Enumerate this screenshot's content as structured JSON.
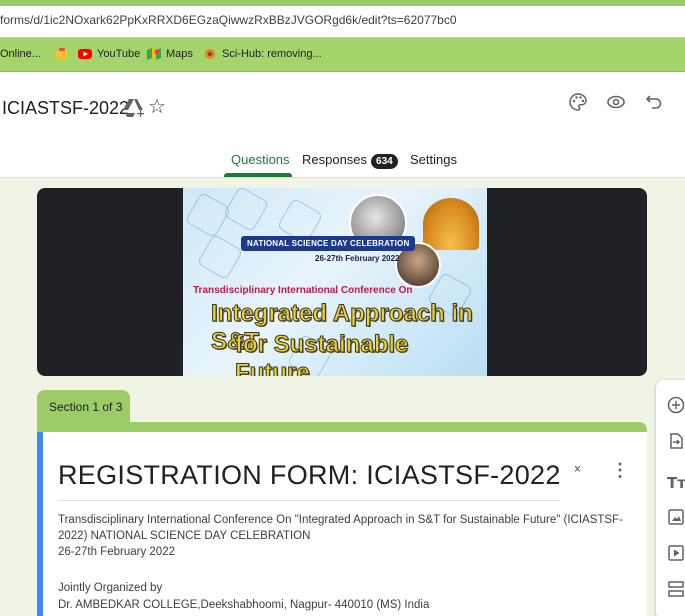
{
  "browser": {
    "url": "forms/d/1ic2NOxark62PpKxRRXD6EGzaQiwwzRxBBzJVGORgd6k/edit?ts=62077bc0",
    "bookmarks": [
      {
        "label": "Online...",
        "icon": "bookmark-page-icon"
      },
      {
        "label": "",
        "icon": "flipkart-icon"
      },
      {
        "label": "YouTube",
        "icon": "youtube-icon"
      },
      {
        "label": "Maps",
        "icon": "maps-icon"
      },
      {
        "label": "Sci-Hub: removing...",
        "icon": "scihub-icon"
      }
    ]
  },
  "header": {
    "doc_title": "ICIASTSF-2022",
    "icons": [
      "move-to-drive-icon",
      "star-icon",
      "palette-icon",
      "preview-eye-icon",
      "undo-icon"
    ],
    "tabs": [
      {
        "label": "Questions",
        "active": true
      },
      {
        "label": "Responses",
        "badge": "634"
      },
      {
        "label": "Settings"
      }
    ]
  },
  "banner": {
    "national_day": "NATIONAL SCIENCE DAY CELEBRATION",
    "dates": "26-27th February 2022",
    "conference": "Transdisciplinary International Conference On",
    "headline_1": "Integrated Approach in S&T",
    "headline_2": "for Sustainable Future"
  },
  "section": {
    "label": "Section 1 of 3",
    "form_title": "REGISTRATION FORM: ICIASTSF-2022",
    "description_lines": [
      "Transdisciplinary International Conference On \"Integrated Approach in S&T for Sustainable Future\" (ICIASTSF-",
      "2022) NATIONAL SCIENCE DAY CELEBRATION",
      "26-27th February 2022",
      "",
      "Jointly Organized by",
      "Dr. AMBEDKAR COLLEGE,Deekshabhoomi, Nagpur- 440010 (MS) India"
    ]
  },
  "toolbar": {
    "items": [
      "add-question-icon",
      "import-questions-icon",
      "add-title-icon",
      "add-image-icon",
      "add-video-icon",
      "add-section-icon"
    ]
  },
  "colors": {
    "accent_green": "#1e7a3a",
    "theme_green": "#9ccc65",
    "background": "#f0f4e4",
    "card_accent": "#4285f4"
  }
}
